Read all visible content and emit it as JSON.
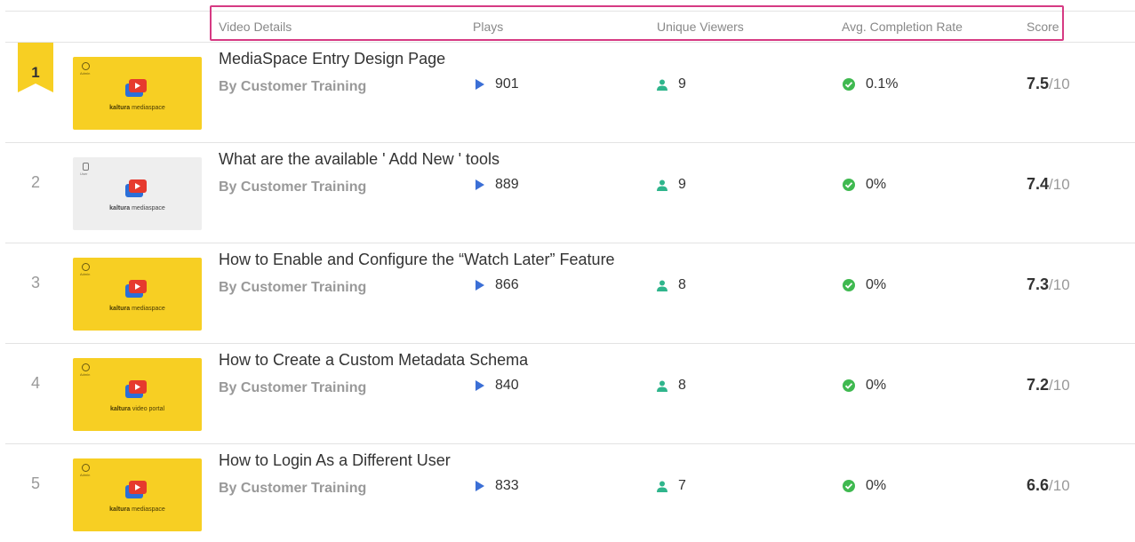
{
  "header": {
    "video_details": "Video Details",
    "plays": "Plays",
    "unique_viewers": "Unique Viewers",
    "avg_completion_rate": "Avg. Completion Rate",
    "score": "Score"
  },
  "colors": {
    "highlight_box": "#d63a83",
    "ribbon": "#f7cf23",
    "play_icon": "#3b6fd6",
    "viewer_icon": "#2fb58c",
    "check_icon": "#3fb950"
  },
  "rows": [
    {
      "rank": "1",
      "title": "MediaSpace Entry Design Page",
      "author": "By Customer Training",
      "plays": "901",
      "viewers": "9",
      "completion": "0.1%",
      "score": "7.5",
      "score_max": "/10",
      "thumb_badge": "Admin",
      "thumb_brand_bold": "kaltura",
      "thumb_brand_rest": " mediaspace",
      "thumb_style": "yellow"
    },
    {
      "rank": "2",
      "title": "What are the available ' Add New ' tools",
      "author": "By Customer Training",
      "plays": "889",
      "viewers": "9",
      "completion": "0%",
      "score": "7.4",
      "score_max": "/10",
      "thumb_badge": "User",
      "thumb_brand_bold": "kaltura",
      "thumb_brand_rest": " mediaspace",
      "thumb_style": "gray"
    },
    {
      "rank": "3",
      "title": "How to Enable and Configure the “Watch Later” Feature",
      "author": "By Customer Training",
      "plays": "866",
      "viewers": "8",
      "completion": "0%",
      "score": "7.3",
      "score_max": "/10",
      "thumb_badge": "Admin",
      "thumb_brand_bold": "kaltura",
      "thumb_brand_rest": " mediaspace",
      "thumb_style": "yellow"
    },
    {
      "rank": "4",
      "title": "How to Create a Custom Metadata Schema",
      "author": "By Customer Training",
      "plays": "840",
      "viewers": "8",
      "completion": "0%",
      "score": "7.2",
      "score_max": "/10",
      "thumb_badge": "Admin",
      "thumb_brand_bold": "kaltura",
      "thumb_brand_rest": " video portal",
      "thumb_style": "yellow"
    },
    {
      "rank": "5",
      "title": "How to Login As a Different User",
      "author": "By Customer Training",
      "plays": "833",
      "viewers": "7",
      "completion": "0%",
      "score": "6.6",
      "score_max": "/10",
      "thumb_badge": "Admin",
      "thumb_brand_bold": "kaltura",
      "thumb_brand_rest": " mediaspace",
      "thumb_style": "yellow"
    }
  ]
}
